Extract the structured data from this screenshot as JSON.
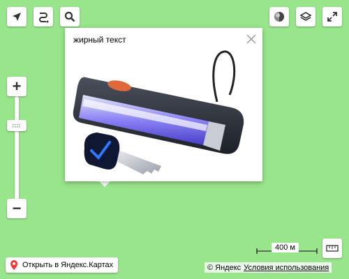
{
  "colors": {
    "map_background": "#98e58b",
    "accent": "#ff3333"
  },
  "controls": {
    "top_left": [
      "navigation-arrow-icon",
      "route-icon",
      "search-icon"
    ],
    "top_right": [
      "traffic-icon",
      "layers-icon",
      "fullscreen-icon"
    ]
  },
  "zoom": {
    "plus": "+",
    "minus": "−"
  },
  "balloon": {
    "text": "жирный текст",
    "image_description_icon": "uv-lamp-with-key-image"
  },
  "scale": {
    "label": "400 м"
  },
  "footer": {
    "open_maps_label": "Открыть в Яндекс.Картах",
    "copyright_label": "© Яндекс",
    "terms_label": "Условия использования"
  }
}
